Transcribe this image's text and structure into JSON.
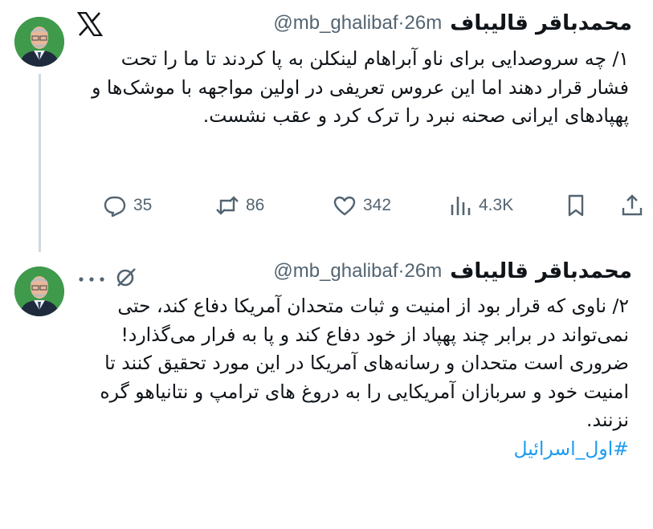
{
  "tweets": [
    {
      "display_name": "محمدباقر قالیباف",
      "handle": "@mb_ghalibaf",
      "separator": "·",
      "time": "26m",
      "text": "۱/ چه سروصدایی برای ناو آبراهام لینکلن به پا کردند تا ما را تحت فشار قرار دهند اما این عروس تعریفی در اولین مواجهه با موشک‌ها و پهپادهای ایرانی صحنه نبرد را ترک کرد و عقب نشست.",
      "stats": {
        "replies": "35",
        "reposts": "86",
        "likes": "342",
        "views": "4.3K"
      }
    },
    {
      "display_name": "محمدباقر قالیباف",
      "handle": "@mb_ghalibaf",
      "separator": "·",
      "time": "26m",
      "text": "۲/ ناوی که قرار بود از امنیت و ثبات متحدان آمریکا دفاع کند، حتی نمی‌تواند در برابر چند پهپاد از خود دفاع کند و پا به فرار می‌گذارد!\nضروری است متحدان و رسانه‌های آمریکا در این مورد تحقیق کنند تا امنیت خود و سربازان آمریکایی را به دروغ های ترامپ و نتانیاهو گره نزنند.",
      "hashtag": "#اول_اسرائیل"
    }
  ],
  "icons": {
    "logo": "x-logo-icon",
    "grok": "grok-icon",
    "more": "more-icon",
    "reply": "reply-icon",
    "repost": "repost-icon",
    "like": "heart-icon",
    "views": "views-icon",
    "bookmark": "bookmark-icon",
    "share": "share-icon"
  },
  "colors": {
    "text": "#0f1419",
    "secondary": "#536471",
    "link": "#1d9bf0",
    "thread_line": "#cfd9de"
  }
}
